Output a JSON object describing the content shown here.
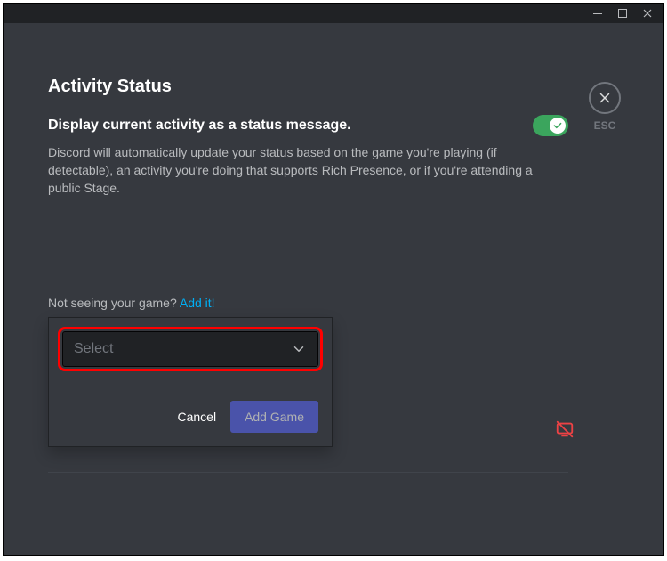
{
  "titlebar": {
    "minimize": "—",
    "maximize": "□",
    "close": "✕"
  },
  "closeLabel": "ESC",
  "page": {
    "title": "Activity Status",
    "settingTitle": "Display current activity as a status message.",
    "settingDesc": "Discord will automatically update your status based on the game you're playing (if detectable), an activity you're doing that supports Rich Presence, or if you're attending a public Stage.",
    "toggleOn": true,
    "notSeeingPrefix": "Not seeing your game? ",
    "addItLink": "Add it!"
  },
  "popup": {
    "selectPlaceholder": "Select",
    "cancelLabel": "Cancel",
    "addGameLabel": "Add Game"
  }
}
